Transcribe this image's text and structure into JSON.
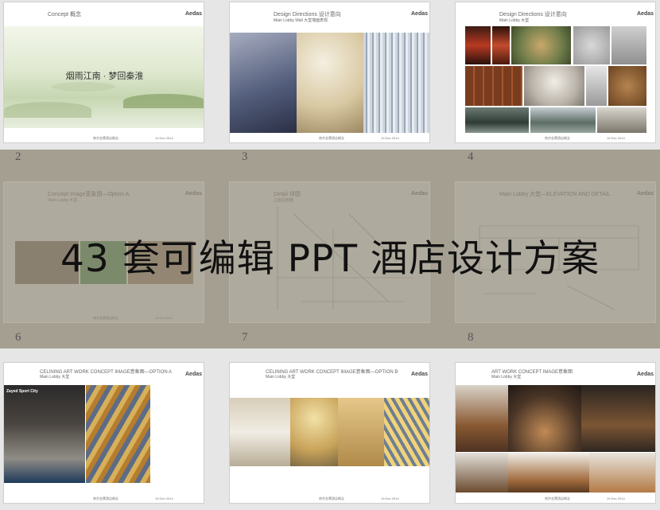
{
  "overlay_text": "43 套可编辑 PPT 酒店设计方案",
  "slide_numbers": [
    "2",
    "3",
    "4",
    "6",
    "7",
    "8"
  ],
  "slides": {
    "s1": {
      "title": "Concept 概念",
      "center": "烟雨江南 · 梦回秦淮",
      "logo": "Aedas",
      "footer_left": "南京金鹰酒店概念",
      "footer_right": "19 Dec 2014"
    },
    "s2": {
      "title": "Design Directions 设计意向",
      "subtitle": "Main Lobby Wall 大堂墙面表现",
      "logo": "Aedas",
      "footer_left": "南京金鹰酒店概念",
      "footer_right": "19 Dec 2014"
    },
    "s3": {
      "title": "Design Directions 设计意向",
      "subtitle": "Main Lobby 大堂",
      "logo": "Aedas",
      "footer_left": "南京金鹰酒店概念",
      "footer_right": "19 Dec 2014"
    },
    "s4": {
      "title": "Concept Image意象图—Option A",
      "subtitle": "Main Lobby 大堂",
      "logo": "Aedas",
      "footer_left": "南京金鹰酒店概念",
      "footer_right": "19 Dec 2014"
    },
    "s5": {
      "title": "Detail 详图",
      "subtitle": "立面及剖面",
      "logo": "Aedas"
    },
    "s6": {
      "title": "Main Lobby 大堂—ELEVATION AND DETAIL",
      "logo": "Aedas"
    },
    "s7": {
      "title": "CELINING ART WORK CONCEPT IMAGE意象图—OPTION A",
      "subtitle": "Main Lobby 大堂",
      "photo_label": "Zayed Sport City",
      "logo": "Aedas",
      "footer_left": "南京金鹰酒店概念",
      "footer_right": "19 Dec 2014"
    },
    "s8": {
      "title": "CELINING ART WORK CONCEPT IMAGE意象图—OPTION B",
      "subtitle": "Main Lobby 大堂",
      "logo": "Aedas",
      "footer_left": "南京金鹰酒店概念",
      "footer_right": "19 Dec 2014"
    },
    "s9": {
      "title": "ART WORK CONCEPT IMAGE意象图",
      "subtitle": "Main Lobby 大堂",
      "logo": "Aedas",
      "footer_left": "南京金鹰酒店概念",
      "footer_right": "19 Dec 2014"
    }
  }
}
